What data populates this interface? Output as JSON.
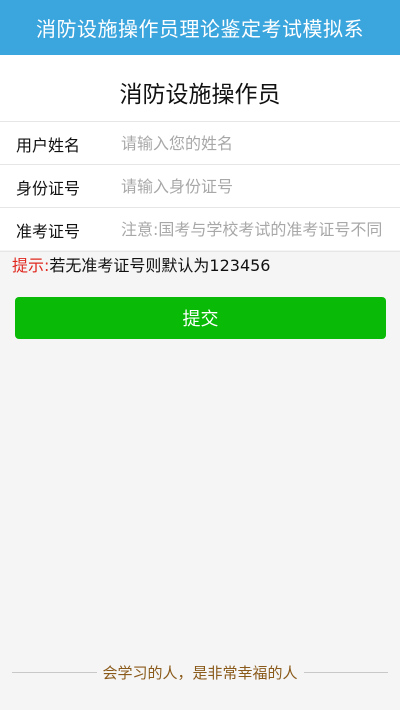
{
  "header": {
    "title": "消防设施操作员理论鉴定考试模拟系"
  },
  "form": {
    "title": "消防设施操作员",
    "fields": [
      {
        "label": "用户姓名",
        "value": "",
        "placeholder": "请输入您的姓名"
      },
      {
        "label": "身份证号",
        "value": "",
        "placeholder": "请输入身份证号"
      },
      {
        "label": "准考证号",
        "value": "",
        "placeholder": "注意:国考与学校考试的准考证号不同"
      }
    ]
  },
  "tip": {
    "label": "提示:",
    "text": "若无准考证号则默认为123456"
  },
  "submit": {
    "label": "提交"
  },
  "footer": {
    "slogan": "会学习的人，是非常幸福的人"
  },
  "colors": {
    "header_bg": "#3ba5dd",
    "submit_bg": "#09bb07",
    "tip_label": "#e0281f",
    "slogan": "#8a5a1a"
  }
}
